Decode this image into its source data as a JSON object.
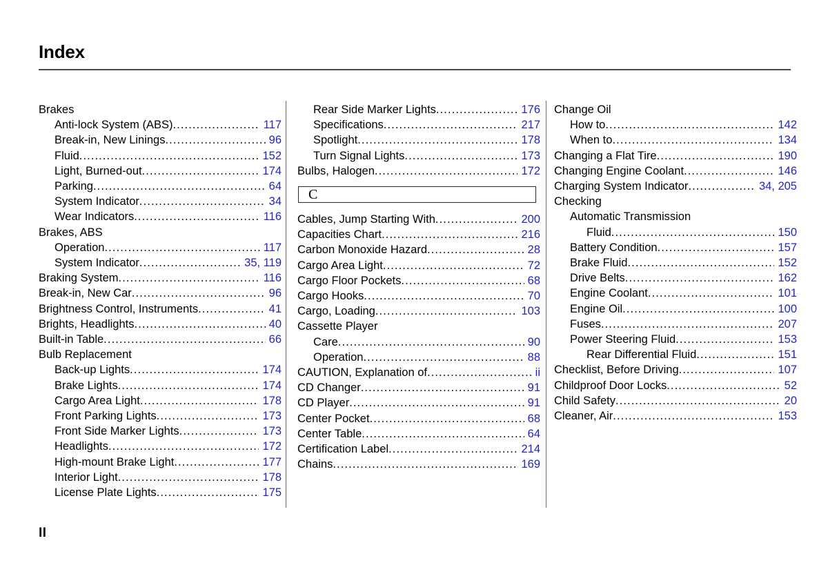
{
  "header": {
    "title": "Index"
  },
  "footer": {
    "folio": "II"
  },
  "leader_dots": "..................................................................................................",
  "accent_color": "#2323c8",
  "columns": [
    {
      "name": "column-1",
      "entries": [
        {
          "level": 0,
          "label": "Brakes",
          "page": ""
        },
        {
          "level": 1,
          "label": "Anti-lock System  (ABS)",
          "page": "117"
        },
        {
          "level": 1,
          "label": "Break-in,  New Linings",
          "page": "96"
        },
        {
          "level": 1,
          "label": "Fluid",
          "page": "152"
        },
        {
          "level": 1,
          "label": "Light,  Burned-out",
          "page": "174"
        },
        {
          "level": 1,
          "label": "Parking",
          "page": "64"
        },
        {
          "level": 1,
          "label": "System  Indicator",
          "page": "34"
        },
        {
          "level": 1,
          "label": "Wear Indicators",
          "page": "116"
        },
        {
          "level": 0,
          "label": "Brakes, ABS",
          "page": ""
        },
        {
          "level": 1,
          "label": "Operation",
          "page": "117"
        },
        {
          "level": 1,
          "label": "System  Indicator",
          "page": "35, 119"
        },
        {
          "level": 0,
          "label": "Braking System",
          "page": "116"
        },
        {
          "level": 0,
          "label": "Break-in, New Car",
          "page": "96"
        },
        {
          "level": 0,
          "label": "Brightness Control, Instruments",
          "page": "41"
        },
        {
          "level": 0,
          "label": "Brights,  Headlights",
          "page": "40"
        },
        {
          "level": 0,
          "label": "Built-in Table",
          "page": "66"
        },
        {
          "level": 0,
          "label": "Bulb  Replacement",
          "page": ""
        },
        {
          "level": 1,
          "label": "Back-up Lights",
          "page": "174"
        },
        {
          "level": 1,
          "label": "Brake Lights",
          "page": "174"
        },
        {
          "level": 1,
          "label": "Cargo Area Light",
          "page": "178"
        },
        {
          "level": 1,
          "label": "Front Parking Lights",
          "page": "173"
        },
        {
          "level": 1,
          "label": "Front Side  Marker Lights",
          "page": "173"
        },
        {
          "level": 1,
          "label": "Headlights",
          "page": "172"
        },
        {
          "level": 1,
          "label": "High-mount  Brake  Light",
          "page": "177"
        },
        {
          "level": 1,
          "label": "Interior  Light",
          "page": "178"
        },
        {
          "level": 1,
          "label": "License Plate Lights",
          "page": "175"
        }
      ]
    },
    {
      "name": "column-2",
      "entries": [
        {
          "level": 1,
          "label": "Rear Side  Marker Lights",
          "page": "176"
        },
        {
          "level": 1,
          "label": "Specifications",
          "page": "217"
        },
        {
          "level": 1,
          "label": "Spotlight",
          "page": "178"
        },
        {
          "level": 1,
          "label": "Turn Signal Lights",
          "page": "173"
        },
        {
          "level": 0,
          "label": "Bulbs, Halogen",
          "page": "172"
        },
        {
          "level": 0,
          "type": "letter-box",
          "label": "C",
          "page": ""
        },
        {
          "level": 0,
          "label": "Cables, Jump Starting With",
          "page": "200"
        },
        {
          "level": 0,
          "label": "Capacities  Chart",
          "page": "216"
        },
        {
          "level": 0,
          "label": "Carbon Monoxide Hazard ",
          "page": "28"
        },
        {
          "level": 0,
          "label": "Cargo Area Light",
          "page": "72"
        },
        {
          "level": 0,
          "label": "Cargo Floor Pockets",
          "page": "68"
        },
        {
          "level": 0,
          "label": "Cargo Hooks",
          "page": "70"
        },
        {
          "level": 0,
          "label": "Cargo, Loading",
          "page": "103"
        },
        {
          "level": 0,
          "label": "Cassette Player",
          "page": ""
        },
        {
          "level": 1,
          "label": "Care",
          "page": "90"
        },
        {
          "level": 1,
          "label": "Operation",
          "page": "88"
        },
        {
          "level": 0,
          "label": "CAUTION,  Explanation of",
          "page": "ii"
        },
        {
          "level": 0,
          "label": "CD  Changer",
          "page": "91"
        },
        {
          "level": 0,
          "label": "CD  Player",
          "page": "91"
        },
        {
          "level": 0,
          "label": "Center Pocket",
          "page": "68"
        },
        {
          "level": 0,
          "label": "Center Table",
          "page": "64"
        },
        {
          "level": 0,
          "label": "Certification Label",
          "page": "214"
        },
        {
          "level": 0,
          "label": "Chains",
          "page": "169"
        }
      ]
    },
    {
      "name": "column-3",
      "entries": [
        {
          "level": 0,
          "label": "Change Oil",
          "page": ""
        },
        {
          "level": 1,
          "label": "How to",
          "page": "142"
        },
        {
          "level": 1,
          "label": "When to",
          "page": "134"
        },
        {
          "level": 0,
          "label": "Changing a Flat Tire ",
          "page": "190"
        },
        {
          "level": 0,
          "label": "Changing Engine Coolant",
          "page": "146"
        },
        {
          "level": 0,
          "label": "Charging System Indicator",
          "page": "34, 205"
        },
        {
          "level": 0,
          "label": "Checking",
          "page": ""
        },
        {
          "level": 1,
          "label": "Automatic Transmission",
          "page": ""
        },
        {
          "level": 2,
          "label": "Fluid",
          "page": "150"
        },
        {
          "level": 1,
          "label": "Battery Condition",
          "page": "157"
        },
        {
          "level": 1,
          "label": "Brake Fluid",
          "page": "152"
        },
        {
          "level": 1,
          "label": "Drive Belts",
          "page": "162"
        },
        {
          "level": 1,
          "label": "Engine Coolant",
          "page": "101"
        },
        {
          "level": 1,
          "label": "Engine Oil",
          "page": "100"
        },
        {
          "level": 1,
          "label": "Fuses",
          "page": "207"
        },
        {
          "level": 1,
          "label": "Power Steering Fluid",
          "page": "153"
        },
        {
          "level": 2,
          "label": "Rear Differential Fluid",
          "page": "151"
        },
        {
          "level": 0,
          "label": "Checklist, Before Driving",
          "page": "107"
        },
        {
          "level": 0,
          "label": "Childproof Door Locks",
          "page": "52"
        },
        {
          "level": 0,
          "label": "Child Safety",
          "page": "20"
        },
        {
          "level": 0,
          "label": "Cleaner, Air",
          "page": "153"
        }
      ]
    }
  ]
}
